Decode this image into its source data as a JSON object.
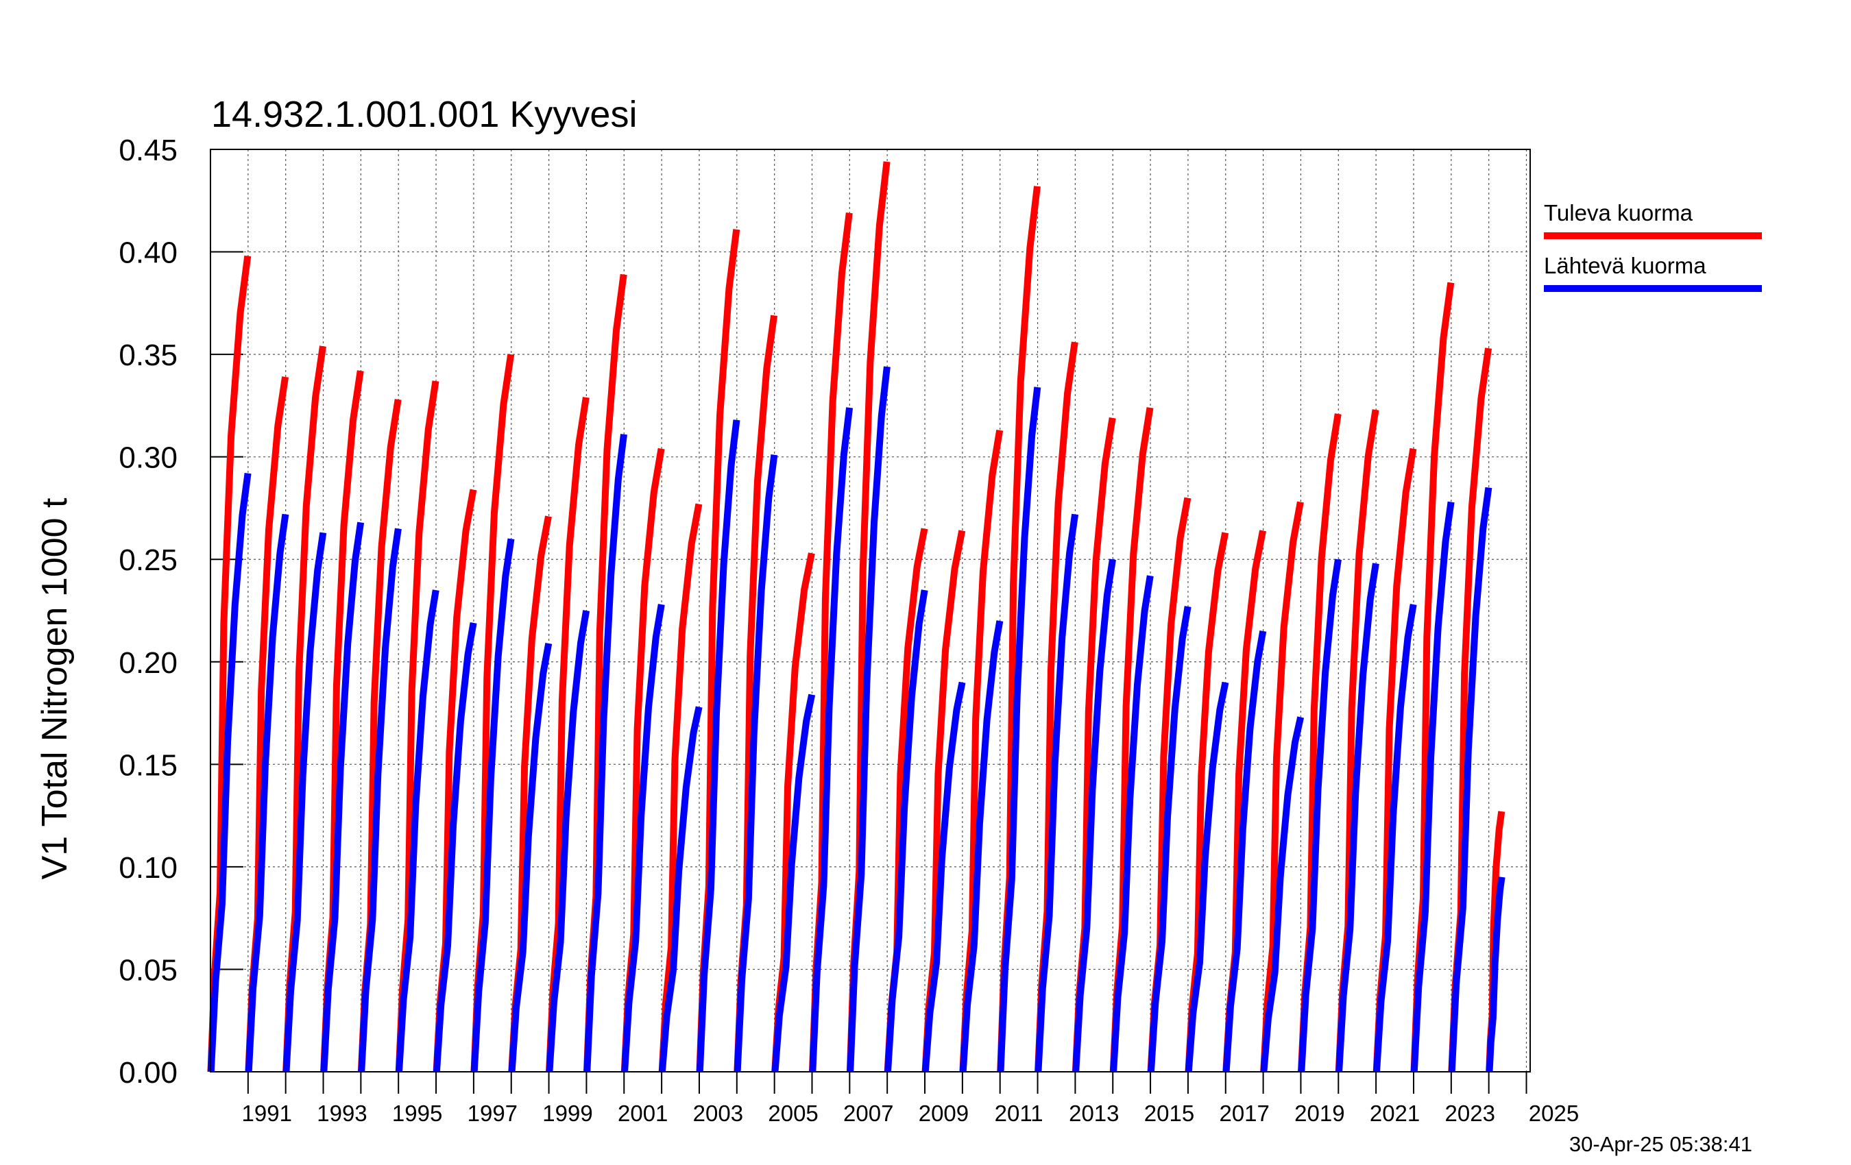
{
  "chart_data": {
    "type": "line",
    "title": "14.932.1.001.001 Kyyvesi",
    "ylabel": "V1 Total Nitrogen 1000 t",
    "xlabel": "",
    "ylim": [
      0,
      0.45
    ],
    "xlim": [
      1990,
      2025.1
    ],
    "grid": true,
    "legend_position": "right",
    "y_ticks": [
      "0.00",
      "0.05",
      "0.10",
      "0.15",
      "0.20",
      "0.25",
      "0.30",
      "0.35",
      "0.40",
      "0.45"
    ],
    "x_tick_labels": [
      "1991",
      "1993",
      "1995",
      "1997",
      "1999",
      "2001",
      "2003",
      "2005",
      "2007",
      "2009",
      "2011",
      "2013",
      "2015",
      "2017",
      "2019",
      "2021",
      "2023",
      "2025"
    ],
    "timestamp": "30-Apr-25 05:38:41",
    "series": [
      {
        "name": "Tuleva kuorma",
        "color": "#ff0000",
        "annual_cumulative_max": {
          "1990": 0.398,
          "1991": 0.339,
          "1992": 0.354,
          "1993": 0.342,
          "1994": 0.328,
          "1995": 0.337,
          "1996": 0.284,
          "1997": 0.35,
          "1998": 0.271,
          "1999": 0.329,
          "2000": 0.389,
          "2001": 0.304,
          "2002": 0.277,
          "2003": 0.411,
          "2004": 0.369,
          "2005": 0.253,
          "2006": 0.419,
          "2007": 0.444,
          "2008": 0.265,
          "2009": 0.264,
          "2010": 0.313,
          "2011": 0.432,
          "2012": 0.356,
          "2013": 0.319,
          "2014": 0.324,
          "2015": 0.28,
          "2016": 0.263,
          "2017": 0.264,
          "2018": 0.278,
          "2019": 0.321,
          "2020": 0.323,
          "2021": 0.304,
          "2022": 0.385,
          "2023": 0.353,
          "2024": 0.127
        }
      },
      {
        "name": "Lähtevä kuorma",
        "color": "#0000ff",
        "annual_cumulative_max": {
          "1990": 0.292,
          "1991": 0.272,
          "1992": 0.263,
          "1993": 0.268,
          "1994": 0.265,
          "1995": 0.235,
          "1996": 0.219,
          "1997": 0.26,
          "1998": 0.209,
          "1999": 0.225,
          "2000": 0.311,
          "2001": 0.228,
          "2002": 0.178,
          "2003": 0.318,
          "2004": 0.301,
          "2005": 0.184,
          "2006": 0.324,
          "2007": 0.344,
          "2008": 0.235,
          "2009": 0.19,
          "2010": 0.22,
          "2011": 0.334,
          "2012": 0.272,
          "2013": 0.25,
          "2014": 0.242,
          "2015": 0.227,
          "2016": 0.19,
          "2017": 0.215,
          "2018": 0.173,
          "2019": 0.25,
          "2020": 0.248,
          "2021": 0.228,
          "2022": 0.278,
          "2023": 0.285,
          "2024": 0.095
        }
      }
    ]
  }
}
